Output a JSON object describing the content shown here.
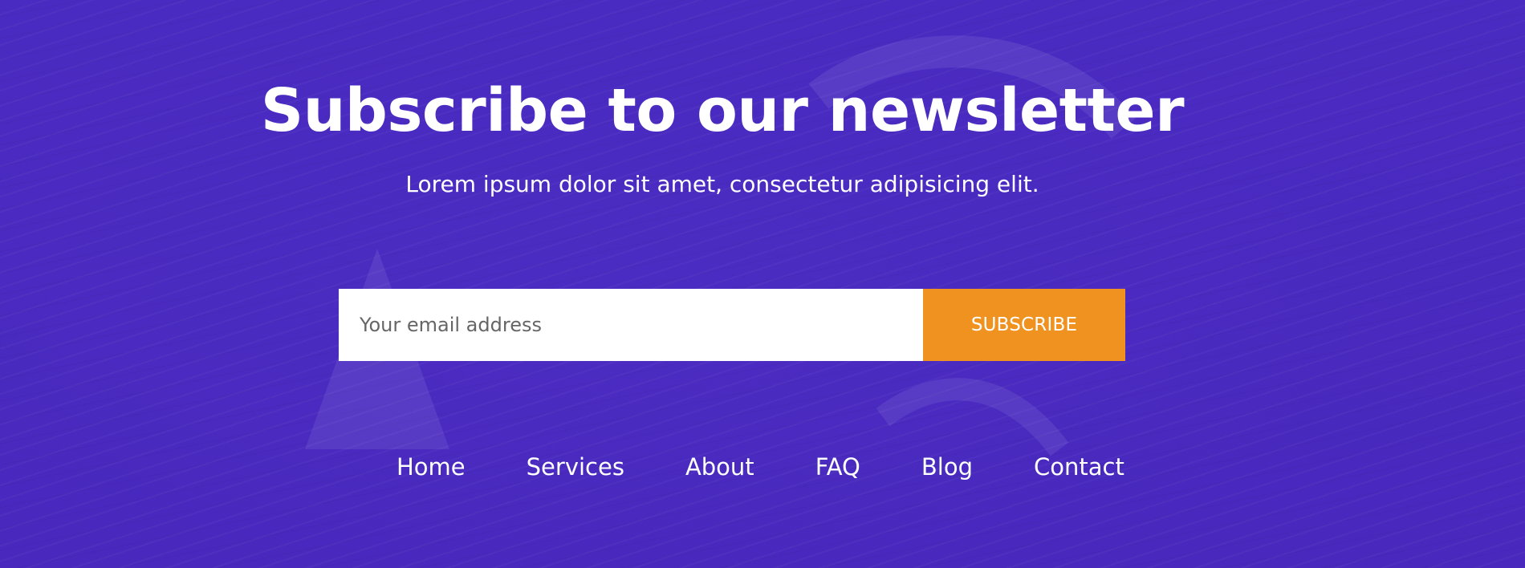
{
  "newsletter": {
    "title": "Subscribe to our newsletter",
    "subtitle": "Lorem ipsum dolor sit amet, consectetur adipisicing elit.",
    "email_placeholder": "Your email address",
    "subscribe_label": "SUBSCRIBE"
  },
  "nav": {
    "items": [
      {
        "label": "Home"
      },
      {
        "label": "Services"
      },
      {
        "label": "About"
      },
      {
        "label": "FAQ"
      },
      {
        "label": "Blog"
      },
      {
        "label": "Contact"
      }
    ]
  },
  "colors": {
    "background": "#4a2bbf",
    "button": "#f0921f",
    "text": "#ffffff"
  }
}
